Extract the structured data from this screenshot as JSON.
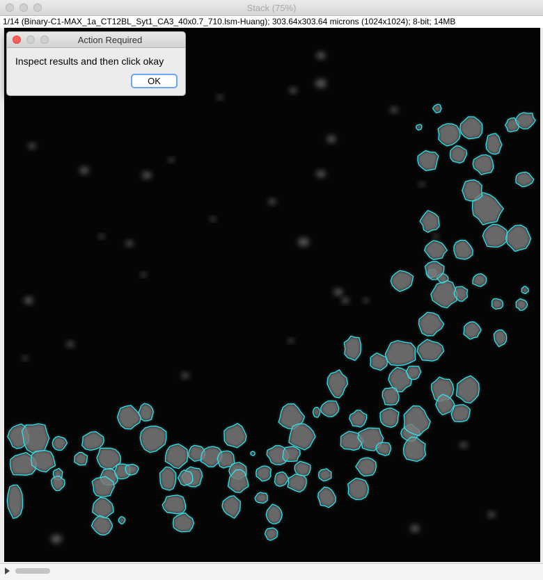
{
  "window": {
    "title": "Stack (75%)",
    "info": "1/14 (Binary-C1-MAX_1a_CT12BL_Syt1_CA3_40x0.7_710.lsm-Huang); 303.64x303.64 microns (1024x1024); 8-bit; 14MB"
  },
  "dialog": {
    "title": "Action Required",
    "message": "Inspect results and then click okay",
    "ok_label": "OK"
  },
  "image": {
    "outline_color": "#2ee6ee",
    "blob_color": "#7a7a7a"
  }
}
